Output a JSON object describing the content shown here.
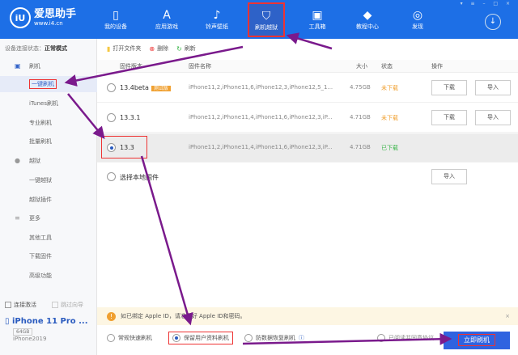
{
  "header": {
    "logo_main": "爱思助手",
    "logo_sub": "www.i4.cn",
    "logo_mark": "iU",
    "nav": [
      {
        "label": "我的设备",
        "icon": "phone-icon"
      },
      {
        "label": "应用游戏",
        "icon": "appstore-icon"
      },
      {
        "label": "铃声壁纸",
        "icon": "music-icon"
      },
      {
        "label": "刷机越狱",
        "icon": "shield-icon"
      },
      {
        "label": "工具箱",
        "icon": "toolbox-icon"
      },
      {
        "label": "教程中心",
        "icon": "graduation-cap-icon"
      },
      {
        "label": "发现",
        "icon": "compass-icon"
      }
    ]
  },
  "sidebar": {
    "status_label": "设备连接状态：",
    "status_value": "正常模式",
    "items": [
      {
        "label": "刷机"
      },
      {
        "label": "一键刷机"
      },
      {
        "label": "iTunes刷机"
      },
      {
        "label": "专业刷机"
      },
      {
        "label": "批量刷机"
      },
      {
        "label": "越狱"
      },
      {
        "label": "一键越狱"
      },
      {
        "label": "越狱插件"
      },
      {
        "label": "更多"
      },
      {
        "label": "其他工具"
      },
      {
        "label": "下载固件"
      },
      {
        "label": "高级功能"
      }
    ],
    "connect_activate": "连接激活",
    "skip_guide": "跳过向导",
    "device": {
      "name": "iPhone 11 Pro ...",
      "capacity": "64GB",
      "nickname": "iPhone2019"
    }
  },
  "toolbar": {
    "open_folder": "打开文件夹",
    "delete": "删除",
    "refresh": "刷新"
  },
  "table": {
    "headers": [
      "固件版本",
      "固件名称",
      "大小",
      "状态",
      "操作"
    ],
    "rows": [
      {
        "version": "13.4beta",
        "badge": "测试版",
        "name": "iPhone11,2,iPhone11,6,iPhone12,3,iPhone12,5_1...",
        "size": "4.75GB",
        "status": "未下载",
        "download": "下载",
        "import": "导入"
      },
      {
        "version": "13.3.1",
        "name": "iPhone11,2,iPhone11,4,iPhone11,6,iPhone12,3,iP...",
        "size": "4.71GB",
        "status": "未下载",
        "download": "下载",
        "import": "导入"
      },
      {
        "version": "13.3",
        "name": "iPhone11,2,iPhone11,4,iPhone11,6,iPhone12,3,iP...",
        "size": "4.71GB",
        "status": "已下载"
      },
      {
        "version": "选择本地固件",
        "import": "导入"
      }
    ]
  },
  "notice": {
    "text": "如已绑定 Apple ID，请准备好 Apple ID和密码。"
  },
  "options": {
    "quick": "常规快速刷机",
    "keep_data": "保留用户资料刷机",
    "anti_recovery": "防数据恢复刷机",
    "extra": "已阅读并同意协议"
  },
  "flash_button": "立即刷机",
  "colors": {
    "brand": "#1d6fe6",
    "status_pending": "#f0a030",
    "status_done": "#3bb54a",
    "annotation": "#7a1a8c"
  }
}
